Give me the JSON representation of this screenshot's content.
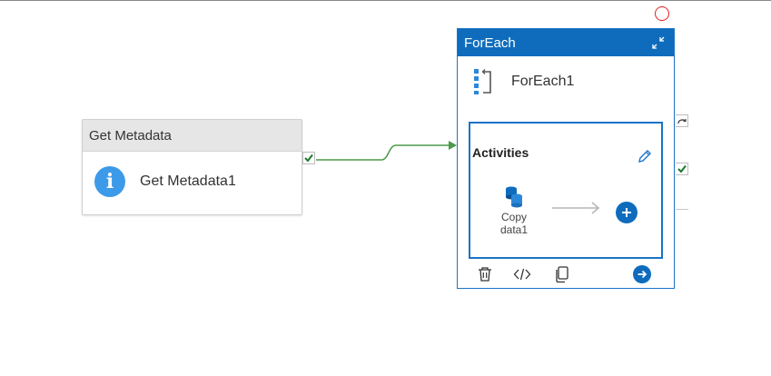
{
  "get_metadata": {
    "type_label": "Get Metadata",
    "name": "Get Metadata1",
    "icon": "info-icon"
  },
  "foreach": {
    "type_label": "ForEach",
    "name": "ForEach1",
    "activities_label": "Activities",
    "inner_activity": {
      "name": "Copy\ndata1",
      "icon": "database-copy-icon"
    }
  },
  "colors": {
    "accent": "#0f6cbd",
    "success": "#2e8b3d",
    "connector": "#4a9a4a",
    "header_grey": "#e6e6e6",
    "marker": "#e02020"
  }
}
